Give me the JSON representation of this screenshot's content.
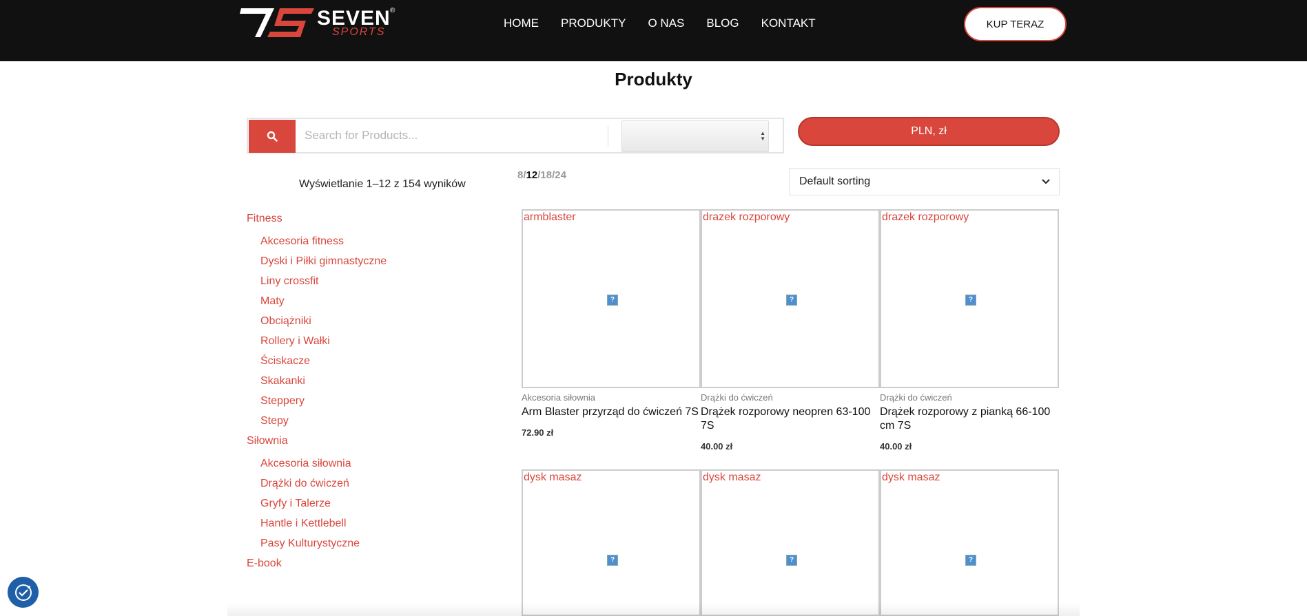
{
  "header": {
    "logo": {
      "mark": "7S",
      "brand": "SEVEN",
      "sub": "SPORTS",
      "reg": "®"
    },
    "nav": [
      "HOME",
      "PRODUKTY",
      "O NAS",
      "BLOG",
      "KONTAKT"
    ],
    "cta_label": "KUP TERAZ"
  },
  "page_title": "Produkty",
  "search": {
    "placeholder": "Search for Products...",
    "category_value": ""
  },
  "currency_label": "PLN, zł",
  "result_count": "Wyświetlanie 1–12 z 154 wyników",
  "per_page": {
    "options": [
      "8",
      "12",
      "18",
      "24"
    ],
    "active": "12"
  },
  "sort": {
    "selected": "Default sorting"
  },
  "sidebar": {
    "groups": [
      {
        "label": "Fitness",
        "items": [
          "Akcesoria fitness",
          "Dyski i Piłki gimnastyczne",
          "Liny crossfit",
          "Maty",
          "Obciążniki",
          "Rollery i Wałki",
          "Ściskacze",
          "Skakanki",
          "Steppery",
          "Stepy"
        ]
      },
      {
        "label": "Siłownia",
        "items": [
          "Akcesoria siłownia",
          "Drążki do ćwiczeń",
          "Gryfy i Talerze",
          "Hantle i Kettlebell",
          "Pasy Kulturystyczne"
        ]
      },
      {
        "label": "E-book",
        "items": []
      }
    ]
  },
  "products": [
    {
      "alt": "armblaster",
      "category": "Akcesoria siłownia",
      "title": "Arm Blaster przyrząd do ćwiczeń 7S",
      "price": "72.90 zł"
    },
    {
      "alt": "drazek rozporowy",
      "category": "Drążki do ćwiczeń",
      "title": "Drążek rozporowy neopren 63-100 7S",
      "price": "40.00 zł"
    },
    {
      "alt": "drazek rozporowy",
      "category": "Drążki do ćwiczeń",
      "title": "Drążek rozporowy z pianką 66-100 cm 7S",
      "price": "40.00 zł"
    },
    {
      "alt": "dysk masaz",
      "category": "",
      "title": "",
      "price": ""
    },
    {
      "alt": "dysk masaz",
      "category": "",
      "title": "",
      "price": ""
    },
    {
      "alt": "dysk masaz",
      "category": "",
      "title": "",
      "price": ""
    }
  ],
  "colors": {
    "accent": "#d9463c",
    "header_bg": "#111111",
    "cookie": "#1f5fa8"
  },
  "icons": {
    "search": "search-icon",
    "cookie": "cookie-settings-icon",
    "sort": "chevron-down-icon",
    "image": "broken-image-icon"
  }
}
